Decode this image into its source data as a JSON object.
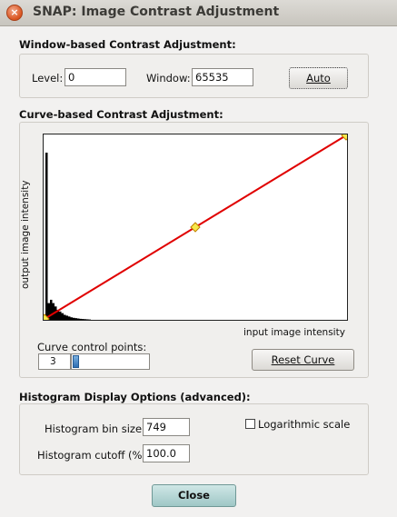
{
  "window": {
    "title": "SNAP: Image Contrast Adjustment",
    "close_glyph": "×"
  },
  "window_section": {
    "heading": "Window-based Contrast Adjustment:",
    "level_label": "Level:",
    "level_value": "0",
    "window_label": "Window:",
    "window_value": "65535",
    "auto_label": "Auto"
  },
  "curve_section": {
    "heading": "Curve-based Contrast Adjustment:",
    "y_axis_label": "output image intensity",
    "x_axis_label": "input image intensity",
    "control_points_label": "Curve control points:",
    "control_points_value": "3",
    "reset_label": "Reset Curve",
    "curve": {
      "control_points": [
        [
          0,
          0
        ],
        [
          0.5,
          0.5
        ],
        [
          1,
          1
        ]
      ],
      "histogram": [
        1.0,
        0.1,
        0.12,
        0.1,
        0.08,
        0.06,
        0.05,
        0.04,
        0.03,
        0.025,
        0.02,
        0.015,
        0.012,
        0.01,
        0.008,
        0.006,
        0.005,
        0.004,
        0.003,
        0.002
      ]
    },
    "colors": {
      "curve": "#e00000",
      "point_fill": "#f7e84a",
      "histogram": "#000000"
    }
  },
  "histogram_section": {
    "heading": "Histogram Display Options (advanced):",
    "bin_size_label": "Histogram bin size:",
    "bin_size_value": "749",
    "log_scale_label": "Logarithmic scale",
    "log_scale_checked": false,
    "cutoff_label": "Histogram cutoff (%):",
    "cutoff_value": "100.0"
  },
  "footer": {
    "close_label": "Close"
  }
}
